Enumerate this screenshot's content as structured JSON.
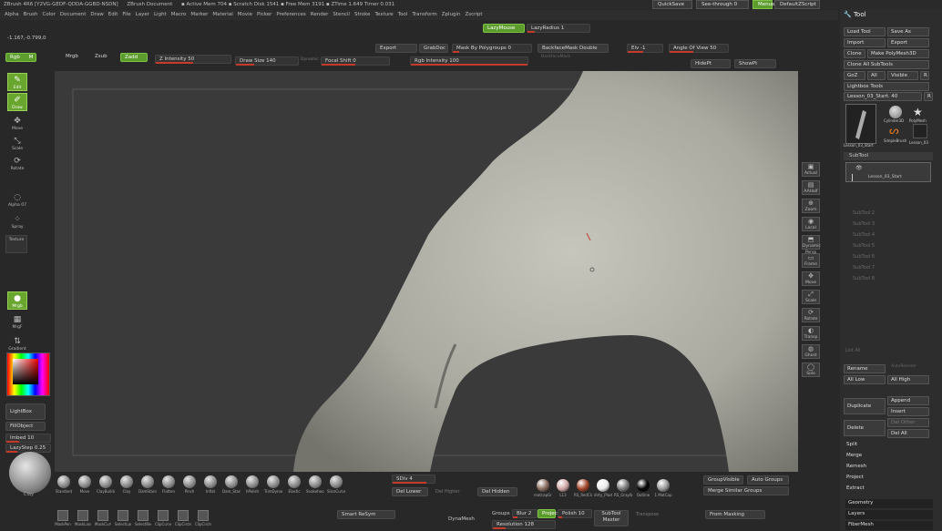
{
  "title": {
    "app": "ZBrush 4R6 [Y2VG-GEDF-QDDA-GGBD-NSDN]",
    "doc": "ZBrush Document",
    "stats": "▪ Active Mem 704 ▪ Scratch Disk 1541 ▪ Free Mem 3191 ▪ ZTime 1.649 Timer 0.031"
  },
  "top_right": {
    "quicksave": "QuickSave",
    "seethrough": "See-through",
    "seethrough_value": "0",
    "menus": "Menus",
    "script": "DefaultZScript"
  },
  "menu": [
    "Alpha",
    "Brush",
    "Color",
    "Document",
    "Draw",
    "Edit",
    "File",
    "Layer",
    "Light",
    "Macro",
    "Marker",
    "Material",
    "Movie",
    "Picker",
    "Preferences",
    "Render",
    "Stencil",
    "Stroke",
    "Texture",
    "Tool",
    "Transform",
    "Zplugin",
    "Zscript"
  ],
  "coords": "-1.167,-0.799,0",
  "lazy": {
    "mouse": "LazyMouse",
    "radius": "LazyRadius 1"
  },
  "toolbar_row1": {
    "export": "Export",
    "grabdoc": "GrabDoc",
    "mask_polygroups": "Mask By Polygroups 0",
    "backface": "BackfaceMask Double",
    "elv": "Elv -1",
    "angle_of_view": "Angle Of View 50"
  },
  "toolbar_row2": {
    "rgb": "Rgb",
    "m": "M",
    "mrgb": "Mrgb",
    "zsub": "Zsub",
    "zadd": "Zadd",
    "z_intensity": "Z Intensity 50",
    "draw_size": "Draw Size 140",
    "dynamic": "Dynamic",
    "focal_shift": "Focal Shift 0",
    "rgb_intensity": "Rgb Intensity 100",
    "backfaceplaceholder": "BackfaceMask",
    "hidept": "HidePt",
    "showpt": "ShowPt"
  },
  "left_tools": [
    "Edit",
    "Draw",
    "Move",
    "Scale",
    "Rotate"
  ],
  "left_alpha": {
    "alpha": "Alpha 07",
    "spray": "Spray",
    "texture": "Texture",
    "mrgb": "Mrgb",
    "mrgb2": "MrgF",
    "gradient": "Gradient",
    "lightbox": "LightBox",
    "fillobject": "FillObject",
    "imbed": "Imbed 10",
    "lazystep": "LazyStep 0.25",
    "clay": "Clay"
  },
  "right_nav": [
    "Actual",
    "AAHalf",
    "Zoom",
    "Local",
    "Dynamic Persp",
    "Frame",
    "Move",
    "Scale",
    "Rotate",
    "Transp",
    "Ghost",
    "Solo"
  ],
  "bottom_brushes": [
    "Standard",
    "Move",
    "ClayBuildup",
    "Clay",
    "DamStandard",
    "Flatten",
    "Pinch",
    "Inflat",
    "Dam_Standard",
    "hPolish",
    "TrimDynamic",
    "Elastic",
    "Snakehook",
    "SliceCurve"
  ],
  "bottom_materials": [
    "matcapGray",
    "L13",
    "RS_RedClay",
    "dirty_Plaster",
    "RS_GrayWax",
    "Outline",
    "1 MatCap"
  ],
  "bottom_strokes": [
    "MaskPen",
    "MaskLasso",
    "MaskCurve",
    "SelectLasso",
    "SelectRect",
    "ClipCurve",
    "ClipCircle",
    "ClipCircleCenter"
  ],
  "bottom_mid": {
    "sdiv": "SDiv 4",
    "del_lower": "Del Lower",
    "del_higher": "Del Higher",
    "high": "Higher",
    "del_hidden": "Del Hidden",
    "groups_visible": "GroupVisible",
    "auto_groups": "Auto Groups",
    "merge_similar": "Merge Similar Groups"
  },
  "bottom_row": {
    "smart_resym": "Smart ReSym",
    "dynamesh": "DynaMesh",
    "groups": "Groups",
    "blur": "Blur 2",
    "project": "Project",
    "polish": "Polish 10",
    "resolution": "Resolution 128",
    "subtool_master": "SubTool Master",
    "transpose": "Transpose",
    "from_masking": "From Masking"
  },
  "tool_panel": {
    "header": "Tool",
    "load": "Load Tool",
    "save_as": "Save As",
    "import": "Import",
    "export": "Export",
    "clone": "Clone",
    "make_poly": "Make PolyMesh3D",
    "clone_all": "Clone All SubTools",
    "goz": "GoZ",
    "all": "All",
    "visible": "Visible",
    "r": "R",
    "lightbox_tools": "Lightbox Tools",
    "current": "Lesson_03_Start. 40",
    "thumbs": [
      "Lesson_03_Start",
      "Cylinder3D",
      "PolyMesh",
      "SimpleBrush",
      "Lesson_03"
    ],
    "subtool": "SubTool",
    "subtool_item": "Lesson_03_Start",
    "subtool_slots": [
      "SubTool 2",
      "SubTool 3",
      "SubTool 4",
      "SubTool 5",
      "SubTool 6",
      "SubTool 7",
      "SubTool 8"
    ],
    "list_all": "List All",
    "auto_reorder": "AutoReorder",
    "rename": "Rename",
    "all_low": "All Low",
    "all_high": "All High",
    "duplicate": "Duplicate",
    "append": "Append",
    "insert": "Insert",
    "delete": "Delete",
    "del_other": "Del Other",
    "del_all": "Del All",
    "split": "Split",
    "merge": "Merge",
    "remesh": "Remesh",
    "project": "Project",
    "extract": "Extract",
    "geometry": "Geometry",
    "layers": "Layers",
    "fibermesh": "FiberMesh"
  },
  "colors": {
    "accent_green": "#5c9c2c",
    "slider_red": "#c43b2c",
    "panel": "#2d2d2d",
    "canvas": "#3a3b3a",
    "model": "#b5b5ac"
  }
}
